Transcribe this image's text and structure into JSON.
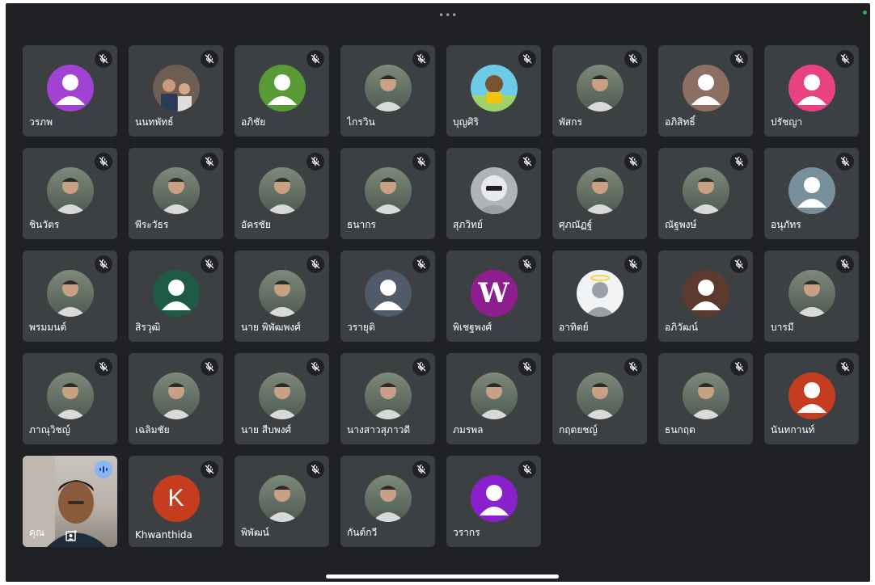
{
  "colors": {
    "background": "#202124",
    "tile": "#3c4043",
    "speaking_indicator": "#8ab4f8"
  },
  "participants": [
    {
      "name": "วรภพ",
      "avatar": "default",
      "color": "#a142d3"
    },
    {
      "name": "นนทพัทธ์",
      "avatar": "photo",
      "photo": "two-people-photo"
    },
    {
      "name": "อภิชัย",
      "avatar": "default",
      "color": "#5a9a36"
    },
    {
      "name": "ไกรวิน",
      "avatar": "photo",
      "photo": "person-photo"
    },
    {
      "name": "บุญศิริ",
      "avatar": "photo",
      "photo": "cartoon-photo"
    },
    {
      "name": "พัสกร",
      "avatar": "photo",
      "photo": "person-photo"
    },
    {
      "name": "อภิสิทธิ์",
      "avatar": "default",
      "color": "#8d6e63"
    },
    {
      "name": "ปรัชญา",
      "avatar": "default",
      "color": "#e8437e"
    },
    {
      "name": "ชินวัตร",
      "avatar": "photo",
      "photo": "person-photo"
    },
    {
      "name": "พีระวัธร",
      "avatar": "photo",
      "photo": "person-photo"
    },
    {
      "name": "อัครชัย",
      "avatar": "photo",
      "photo": "person-photo"
    },
    {
      "name": "ธนากร",
      "avatar": "photo",
      "photo": "person-photo"
    },
    {
      "name": "สุภวิทย์",
      "avatar": "photo",
      "photo": "sunglasses-photo"
    },
    {
      "name": "ศุภณัฏฐ์",
      "avatar": "photo",
      "photo": "person-photo"
    },
    {
      "name": "ณัฐพงษ์",
      "avatar": "photo",
      "photo": "person-photo"
    },
    {
      "name": "อนุภัทร",
      "avatar": "default",
      "color": "#78909c"
    },
    {
      "name": "พรมมนต์",
      "avatar": "photo",
      "photo": "person-photo"
    },
    {
      "name": "สิรวุฒิ",
      "avatar": "default",
      "color": "#1e5b45"
    },
    {
      "name": "นาย พิพัฒพงศ์",
      "avatar": "photo",
      "photo": "person-photo"
    },
    {
      "name": "วรายุติ",
      "avatar": "default",
      "color": "#4f5b66"
    },
    {
      "name": "พิเชฐพงศ์",
      "avatar": "letter",
      "letter": "W",
      "color": "#8e1e8e"
    },
    {
      "name": "อาทิตย์",
      "avatar": "photo",
      "photo": "halo-photo"
    },
    {
      "name": "อภิวัฒน์",
      "avatar": "default",
      "color": "#5d3a2e"
    },
    {
      "name": "บารมี",
      "avatar": "photo",
      "photo": "person-photo"
    },
    {
      "name": "ภาณุวิชญ์",
      "avatar": "photo",
      "photo": "person-photo"
    },
    {
      "name": "เฉลิมชัย",
      "avatar": "photo",
      "photo": "person-photo"
    },
    {
      "name": "นาย สืบพงศ์",
      "avatar": "photo",
      "photo": "person-photo"
    },
    {
      "name": "นางสาวสุภาวดี",
      "avatar": "photo",
      "photo": "person-photo"
    },
    {
      "name": "ภมรพล",
      "avatar": "photo",
      "photo": "person-photo"
    },
    {
      "name": "กฤตยชญ์",
      "avatar": "photo",
      "photo": "person-photo"
    },
    {
      "name": "ธนกฤต",
      "avatar": "photo",
      "photo": "person-photo"
    },
    {
      "name": "นันทกานท์",
      "avatar": "default",
      "color": "#c63c1e"
    },
    {
      "name": "คุณ",
      "avatar": "self"
    },
    {
      "name": "Khwanthida",
      "avatar": "letter",
      "letter": "K",
      "color": "#c63c1e"
    },
    {
      "name": "พิพัฒน์",
      "avatar": "photo",
      "photo": "person-photo"
    },
    {
      "name": "กันต์กวี",
      "avatar": "photo",
      "photo": "person-photo"
    },
    {
      "name": "วรากร",
      "avatar": "default",
      "color": "#8a1fcc"
    }
  ]
}
